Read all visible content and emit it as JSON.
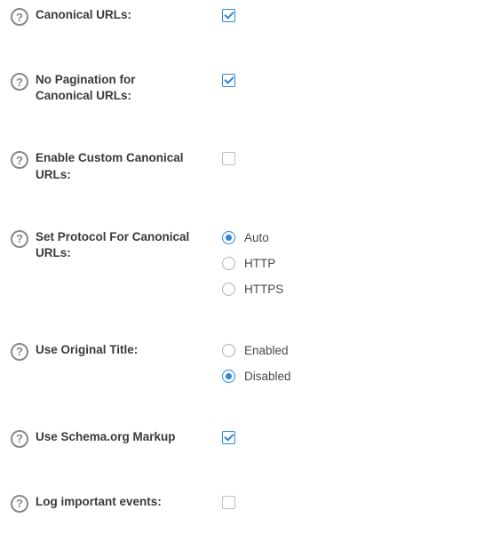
{
  "settings": [
    {
      "key": "canonical",
      "label": "Canonical URLs:",
      "type": "checkbox",
      "checked": true
    },
    {
      "key": "no-pagination",
      "label": "No Pagination for Canonical URLs:",
      "type": "checkbox",
      "checked": true
    },
    {
      "key": "custom-canonical",
      "label": "Enable Custom Canonical URLs:",
      "type": "checkbox",
      "checked": false
    },
    {
      "key": "protocol",
      "label": "Set Protocol For Canonical URLs:",
      "type": "radio",
      "selected": "auto",
      "options": [
        {
          "value": "auto",
          "label": "Auto"
        },
        {
          "value": "http",
          "label": "HTTP"
        },
        {
          "value": "https",
          "label": "HTTPS"
        }
      ]
    },
    {
      "key": "original-title",
      "label": "Use Original Title:",
      "type": "radio",
      "selected": "disabled",
      "options": [
        {
          "value": "enabled",
          "label": "Enabled"
        },
        {
          "value": "disabled",
          "label": "Disabled"
        }
      ]
    },
    {
      "key": "schema",
      "label": "Use Schema.org Markup",
      "type": "checkbox",
      "checked": true
    },
    {
      "key": "log-events",
      "label": "Log important events:",
      "type": "checkbox",
      "checked": false
    }
  ]
}
